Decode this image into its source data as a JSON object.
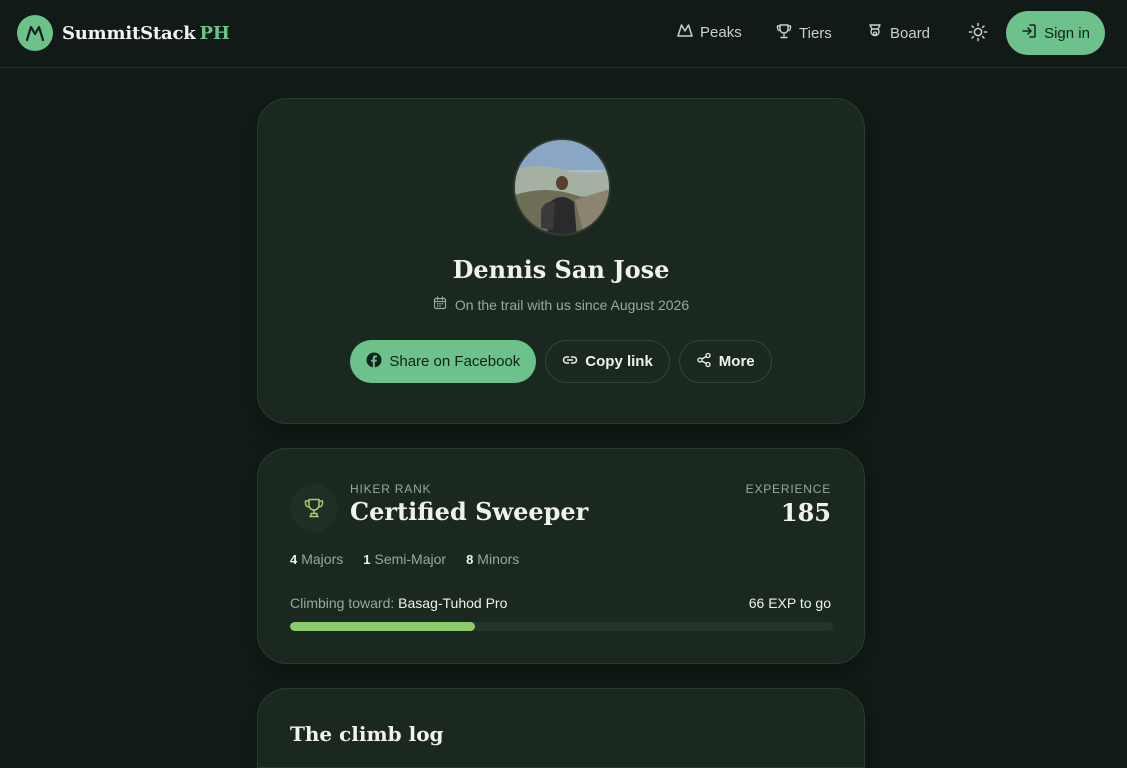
{
  "header": {
    "brand": "SummitStack",
    "brand_accent": "PH",
    "nav": [
      {
        "label": "Peaks",
        "icon": "mountain-icon"
      },
      {
        "label": "Tiers",
        "icon": "trophy-icon"
      },
      {
        "label": "Board",
        "icon": "badge-icon"
      }
    ],
    "theme_icon": "sun-icon",
    "signin_label": "Sign in"
  },
  "profile": {
    "name": "Dennis San Jose",
    "since": "On the trail with us since August 2026",
    "actions": {
      "facebook": "Share on Facebook",
      "copy": "Copy link",
      "more": "More"
    }
  },
  "rank": {
    "label": "HIKER RANK",
    "title": "Certified Sweeper",
    "exp_label": "EXPERIENCE",
    "exp_value": "185",
    "counts": {
      "majors_n": "4",
      "majors": "Majors",
      "semi_n": "1",
      "semi": "Semi-Major",
      "minors_n": "8",
      "minors": "Minors"
    },
    "toward_label": "Climbing toward:",
    "toward_target": "Basag-Tuhod Pro",
    "to_go": "66 EXP to go",
    "progress": 0.34
  },
  "log": {
    "title": "The climb log"
  },
  "colors": {
    "accent": "#6cc28a",
    "bg": "#111c17",
    "card": "#1a2820",
    "progress": "#8ccc6e"
  }
}
